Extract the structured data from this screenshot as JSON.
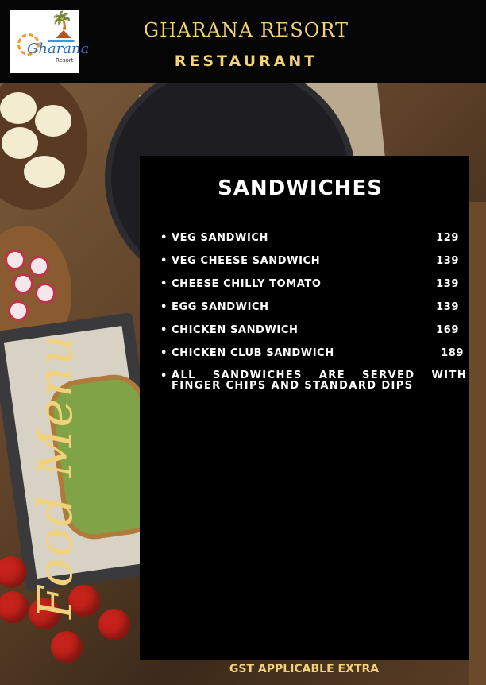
{
  "header": {
    "logo": {
      "script": "Gharana",
      "sub": "Resort"
    },
    "resort_name": "GHARANA RESORT",
    "subtitle": "RESTAURANT"
  },
  "side_title": "Food Menu",
  "section": {
    "title": "SANDWICHES",
    "items": [
      {
        "name": "VEG SANDWICH",
        "price": "129"
      },
      {
        "name": "VEG CHEESE SANDWICH",
        "price": "139"
      },
      {
        "name": "CHEESE CHILLY TOMATO",
        "price": "139"
      },
      {
        "name": "EGG SANDWICH",
        "price": "139"
      },
      {
        "name": "CHICKEN SANDWICH",
        "price": "169"
      },
      {
        "name": "CHICKEN CLUB SANDWICH",
        "price": "189"
      }
    ],
    "note": "ALL SANDWICHES ARE SERVED WITH FINGER CHIPS AND STANDARD DIPS"
  },
  "footer": "GST APPLICABLE EXTRA",
  "colors": {
    "gold": "#f1d27a",
    "panel": "#000000",
    "header": "#050505"
  }
}
